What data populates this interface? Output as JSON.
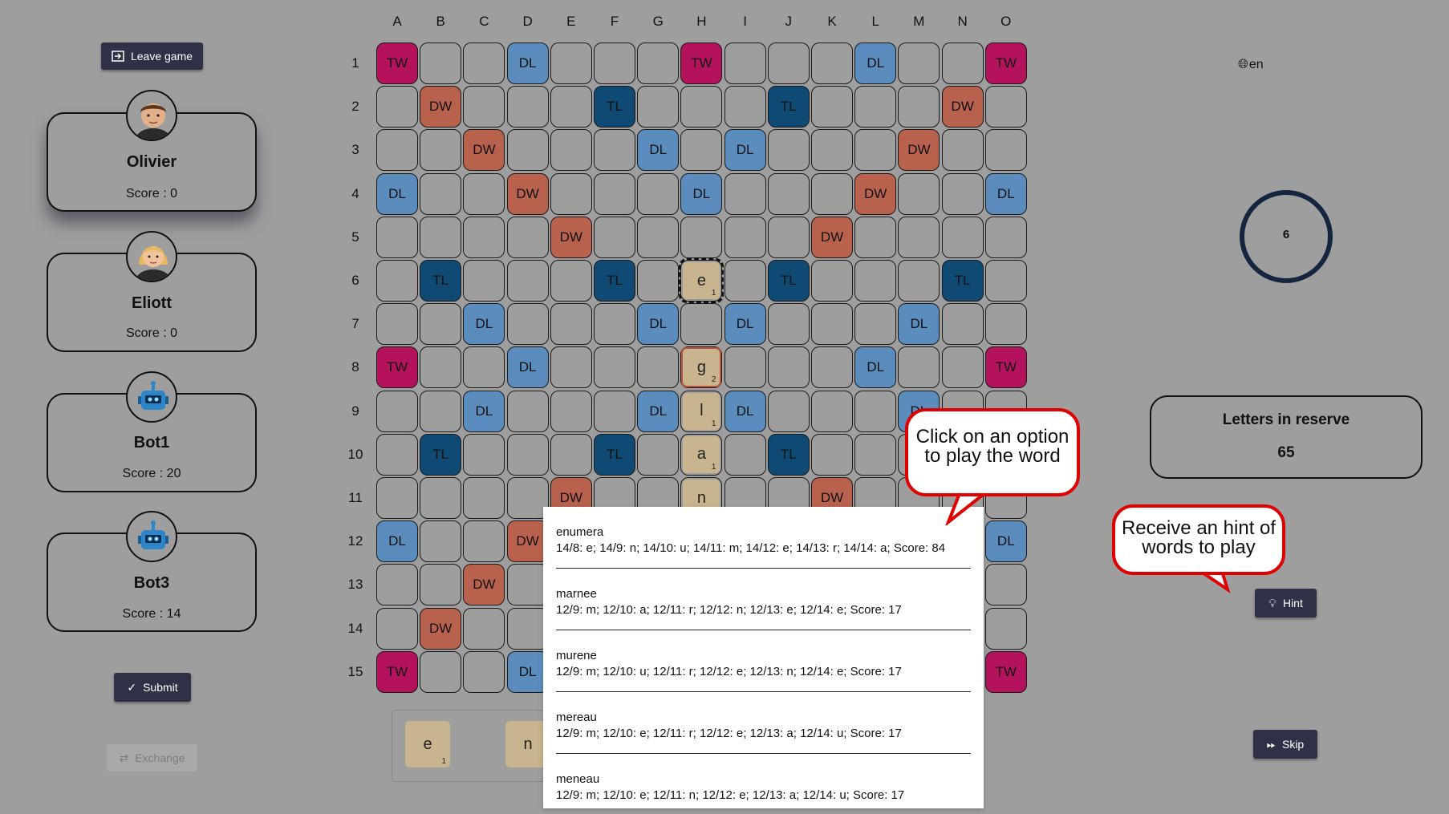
{
  "header": {
    "language_label": "en"
  },
  "columns": [
    "A",
    "B",
    "C",
    "D",
    "E",
    "F",
    "G",
    "H",
    "I",
    "J",
    "K",
    "L",
    "M",
    "N",
    "O"
  ],
  "rows": [
    "1",
    "2",
    "3",
    "4",
    "5",
    "6",
    "7",
    "8",
    "9",
    "10",
    "11",
    "12",
    "13",
    "14",
    "15"
  ],
  "actions": {
    "leave_label": "Leave game",
    "submit_label": "Submit",
    "exchange_label": "Exchange",
    "hint_label": "Hint",
    "skip_label": "Skip"
  },
  "players": [
    {
      "name": "Olivier",
      "score": "Score : 0",
      "avatar": "man-avatar-icon"
    },
    {
      "name": "Eliott",
      "score": "Score : 0",
      "avatar": "woman-avatar-icon"
    },
    {
      "name": "Bot1",
      "score": "Score : 20",
      "avatar": "robot-icon"
    },
    {
      "name": "Bot3",
      "score": "Score : 14",
      "avatar": "robot-icon"
    }
  ],
  "timer": {
    "value": "6"
  },
  "reserve": {
    "title": "Letters in reserve",
    "count": "65"
  },
  "board": {
    "layout": [
      "TW,,,DL,,,,TW,,,,DL,,,TW",
      ",DW,,,,TL,,,,TL,,,,DW,",
      ",,DW,,,,DL,,DL,,,,DW,,",
      "DL,,,DW,,,,DL,,,,DW,,,DL",
      ",,,,DW,,,,,,DW,,,,",
      ",TL,,,,TL,,,,TL,,,,TL,",
      ",,DL,,,,DL,,DL,,,,DL,,",
      "TW,,,DL,,,,,,,,DL,,,TW",
      ",,DL,,,,DL,,DL,,,,DL,,",
      ",TL,,,,TL,,,,TL,,,,TL,",
      ",,,,DW,,,,,,DW,,,,",
      "DL,,,DW,,,,DL,,,,DW,,,DL",
      ",,DW,,,,DL,,DL,,,,DW,,",
      ",DW,,,,TL,,,,TL,,,,DW,",
      "TW,,,DL,,,,TW,,,,DL,,,TW"
    ],
    "tiles": [
      {
        "row": 6,
        "col": 8,
        "letter": "e",
        "points": "1"
      },
      {
        "row": 8,
        "col": 8,
        "letter": "g",
        "points": "2"
      },
      {
        "row": 9,
        "col": 8,
        "letter": "l",
        "points": "1"
      },
      {
        "row": 10,
        "col": 8,
        "letter": "a",
        "points": "1"
      },
      {
        "row": 11,
        "col": 8,
        "letter": "n",
        "points": "1"
      }
    ]
  },
  "rack": [
    {
      "letter": "e",
      "points": "1"
    },
    {
      "letter": "n",
      "points": ""
    }
  ],
  "hint_options": [
    {
      "word": "enumera",
      "detail": "14/8: e; 14/9: n; 14/10: u; 14/11: m; 14/12: e; 14/13: r; 14/14: a; Score: 84"
    },
    {
      "word": "marnee",
      "detail": "12/9: m; 12/10: a; 12/11: r; 12/12: n; 12/13: e; 12/14: e; Score: 17"
    },
    {
      "word": "murene",
      "detail": "12/9: m; 12/10: u; 12/11: r; 12/12: e; 12/13: n; 12/14: e; Score: 17"
    },
    {
      "word": "mereau",
      "detail": "12/9: m; 12/10: e; 12/11: r; 12/12: e; 12/13: a; 12/14: u; Score: 17"
    },
    {
      "word": "meneau",
      "detail": "12/9: m; 12/10: e; 12/11: n; 12/12: e; 12/13: a; 12/14: u; Score: 17"
    }
  ],
  "callouts": {
    "options_line1": "Click on an option",
    "options_line2": "to play the word",
    "hint_line1": "Receive an hint of",
    "hint_line2": "words to play"
  },
  "colors": {
    "tw": "#b5125e",
    "dw": "#b8624d",
    "tl": "#0e4a73",
    "dl": "#5a8cbe",
    "callout_border": "#e00000"
  }
}
